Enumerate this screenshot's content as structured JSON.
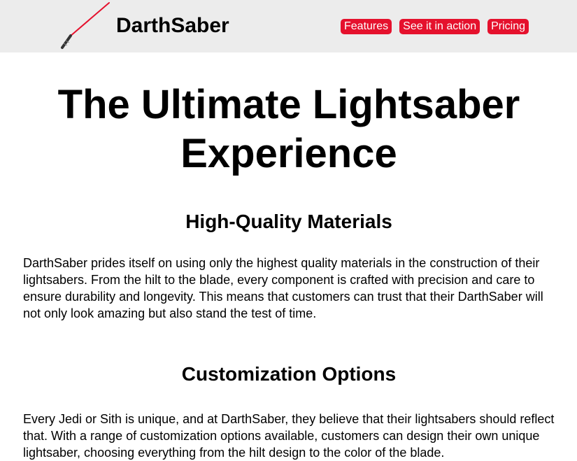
{
  "header": {
    "brand": "DarthSaber",
    "nav": [
      {
        "label": "Features"
      },
      {
        "label": "See it in action"
      },
      {
        "label": "Pricing"
      }
    ]
  },
  "hero": {
    "title": "The Ultimate Lightsaber Experience"
  },
  "sections": [
    {
      "title": "High-Quality Materials",
      "body": "DarthSaber prides itself on using only the highest quality materials in the construction of their lightsabers. From the hilt to the blade, every component is crafted with precision and care to ensure durability and longevity. This means that customers can trust that their DarthSaber will not only look amazing but also stand the test of time."
    },
    {
      "title": "Customization Options",
      "body": "Every Jedi or Sith is unique, and at DarthSaber, they believe that their lightsabers should reflect that. With a range of customization options available, customers can design their own unique lightsaber, choosing everything from the hilt design to the color of the blade."
    }
  ],
  "colors": {
    "accent": "#e5112d",
    "header_bg": "#ececec"
  },
  "icons": {
    "logo": "lightsaber-icon"
  }
}
